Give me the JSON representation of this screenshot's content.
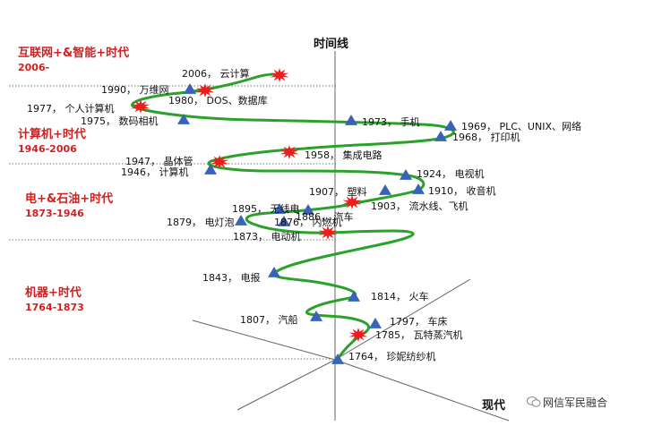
{
  "axis": {
    "vertical_title": "时间线",
    "horizontal_title": "现代"
  },
  "eras": [
    {
      "name": "互联网+&智能+时代",
      "range": "2006-"
    },
    {
      "name": "计算机+时代",
      "range": "1946-2006"
    },
    {
      "name": "电+&石油+时代",
      "range": "1873-1946"
    },
    {
      "name": "机器+时代",
      "range": "1764-1873"
    }
  ],
  "milestones": [
    {
      "label": "2006， 云计算",
      "marker": "star"
    },
    {
      "label": "1990， 万维网",
      "marker": "star"
    },
    {
      "label": "1980， DOS、数据库",
      "marker": "triangle"
    },
    {
      "label": "1977， 个人计算机",
      "marker": "star"
    },
    {
      "label": "1975， 数码相机",
      "marker": "triangle"
    },
    {
      "label": "1973， 手机",
      "marker": "triangle"
    },
    {
      "label": "1969， PLC、UNIX、网络",
      "marker": "triangle"
    },
    {
      "label": "1968， 打印机",
      "marker": "triangle"
    },
    {
      "label": "1958， 集成电路",
      "marker": "star"
    },
    {
      "label": "1947， 晶体管",
      "marker": "star"
    },
    {
      "label": "1946， 计算机",
      "marker": "triangle"
    },
    {
      "label": "1924， 电视机",
      "marker": "triangle"
    },
    {
      "label": "1907， 塑料",
      "marker": "triangle"
    },
    {
      "label": "1910， 收音机",
      "marker": "triangle"
    },
    {
      "label": "1903， 流水线、飞机",
      "marker": "star"
    },
    {
      "label": "1895， 无线电",
      "marker": "triangle"
    },
    {
      "label": "1886， 汽车",
      "marker": "triangle"
    },
    {
      "label": "1879， 电灯泡",
      "marker": "triangle"
    },
    {
      "label": "1876， 内燃机",
      "marker": "triangle"
    },
    {
      "label": "1873， 电动机",
      "marker": "star"
    },
    {
      "label": "1843， 电报",
      "marker": "triangle"
    },
    {
      "label": "1814， 火车",
      "marker": "triangle"
    },
    {
      "label": "1807， 汽船",
      "marker": "triangle"
    },
    {
      "label": "1797， 车床",
      "marker": "triangle"
    },
    {
      "label": "1785， 瓦特蒸汽机",
      "marker": "star"
    },
    {
      "label": "1764， 珍妮纺纱机",
      "marker": "triangle"
    }
  ],
  "watermark": {
    "text": "网信军民融合"
  },
  "colors": {
    "curve": "#2aa12a",
    "triangle": "#3a62b6",
    "star": "#ee1c1c",
    "era_text": "#d0201f",
    "axis": "#666666"
  }
}
